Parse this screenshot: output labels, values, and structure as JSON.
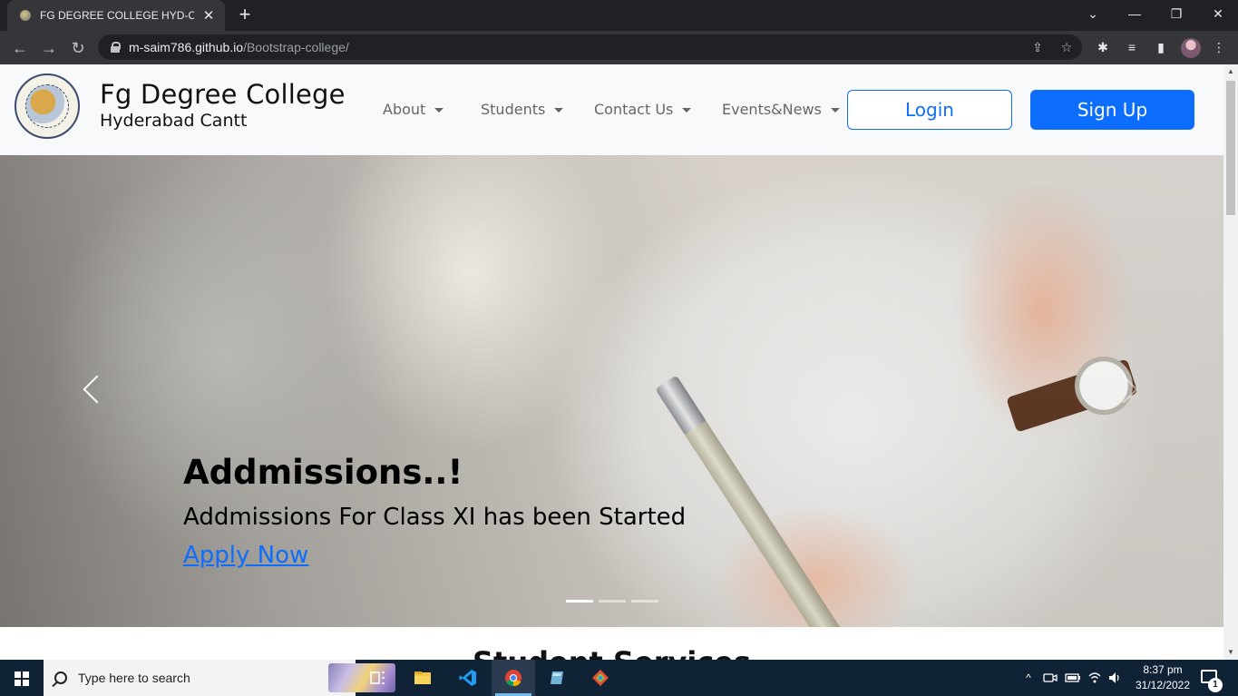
{
  "browser": {
    "tab_title": "FG DEGREE COLLEGE HYD-CANTT",
    "tab_close": "✕",
    "new_tab": "+",
    "url_host": "m-saim786.github.io",
    "url_path": "/Bootstrap-college/",
    "window_controls": {
      "tabsearch": "⌄",
      "minimize": "—",
      "maximize": "❐",
      "close": "✕"
    },
    "nav": {
      "back": "←",
      "forward": "→",
      "reload": "↻"
    },
    "toolbar_icons": {
      "share": "⇪",
      "bookmark": "☆",
      "extensions": "✱",
      "media": "≡",
      "sidepanel": "▮",
      "menu": "⋮"
    }
  },
  "site": {
    "brand": {
      "name": "Fg Degree College",
      "subtitle": "Hyderabad Cantt"
    },
    "menu": [
      {
        "label": "About"
      },
      {
        "label": "Students"
      },
      {
        "label": "Contact Us"
      },
      {
        "label": "Events&News"
      }
    ],
    "buttons": {
      "login": "Login",
      "signup": "Sign Up"
    },
    "carousel": {
      "slide_title": "Addmissions..!",
      "slide_text": "Addmissions For Class XI has been Started",
      "slide_link": "Apply Now",
      "indicator_count": 3,
      "active_index": 0
    },
    "next_section_heading": "Student Services"
  },
  "taskbar": {
    "search_placeholder": "Type here to search",
    "time": "8:37 pm",
    "date": "31/12/2022",
    "notification_count": "1",
    "tray_icons": {
      "chevron": "^"
    }
  }
}
